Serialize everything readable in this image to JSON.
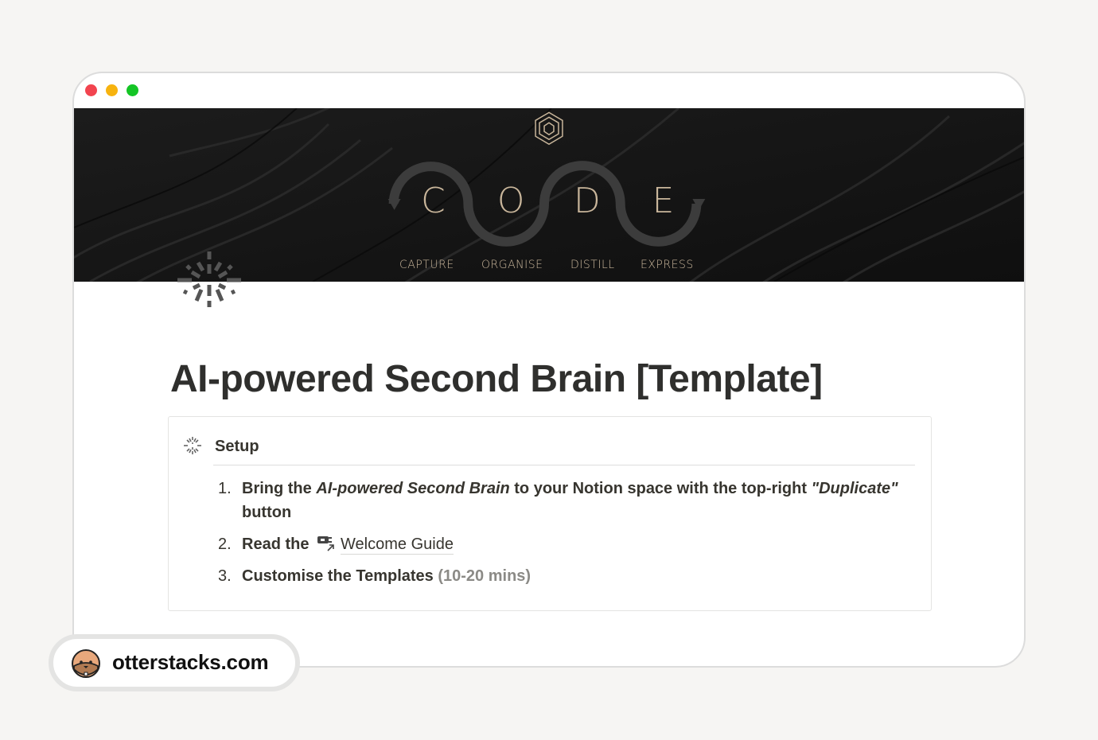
{
  "window": {
    "controls": [
      "close",
      "minimize",
      "maximize"
    ],
    "colors": {
      "close": "#f2444f",
      "minimize": "#f7b30f",
      "maximize": "#14c525"
    }
  },
  "cover": {
    "letters": [
      "C",
      "O",
      "D",
      "E"
    ],
    "labels": [
      "CAPTURE",
      "ORGANISE",
      "DISTILL",
      "EXPRESS"
    ],
    "accent_color": "#c9b69b",
    "logo_icon": "hexagon-cube-icon"
  },
  "page": {
    "icon": "sparkle-burst-icon",
    "title": "AI-powered Second Brain [Template]"
  },
  "callout": {
    "icon": "sparkle-burst-icon",
    "heading": "Setup",
    "steps": [
      {
        "number": "1.",
        "pre": "Bring the ",
        "italic": "AI-powered Second Brain",
        "mid": " to your Notion space with the top-right ",
        "italic2": "\"Duplicate\"",
        "post": " button"
      },
      {
        "number": "2.",
        "pre": "Read the ",
        "link_icon": "plug-link-icon",
        "link": "Welcome Guide"
      },
      {
        "number": "3.",
        "pre": "Customise the Templates ",
        "muted": "(10-20 mins)"
      }
    ]
  },
  "badge": {
    "avatar": "otter-face-icon",
    "text": "otterstacks.com"
  }
}
